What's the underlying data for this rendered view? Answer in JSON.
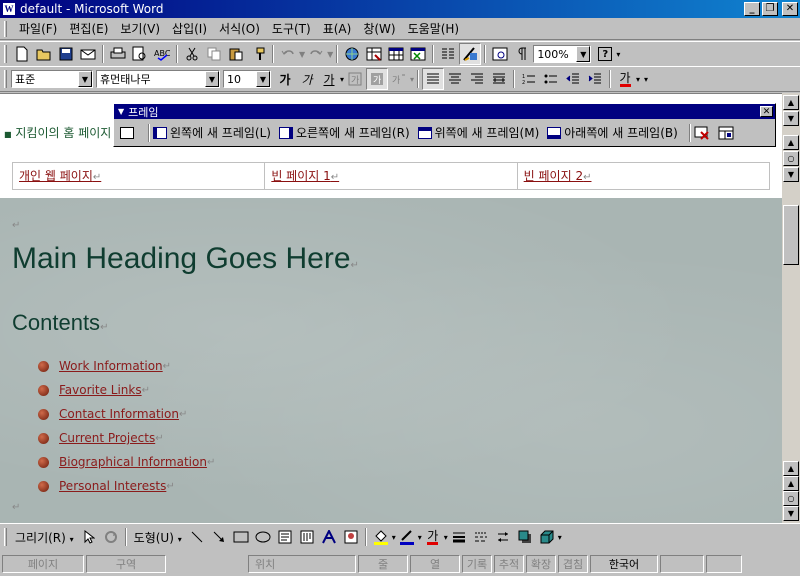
{
  "window": {
    "title": "default - Microsoft Word",
    "app_icon": "W",
    "min_label": "_",
    "max_label": "❐",
    "close_label": "✕"
  },
  "menu": [
    "파일(F)",
    "편집(E)",
    "보기(V)",
    "삽입(I)",
    "서식(O)",
    "도구(T)",
    "표(A)",
    "창(W)",
    "도움말(H)"
  ],
  "toolbar": {
    "zoom": "100%",
    "help_glyph": "?"
  },
  "formatting": {
    "style": "표준",
    "font": "휴먼태나무",
    "size": "10",
    "bold": "가",
    "italic": "가",
    "underline": "가",
    "font_color_glyph": "가"
  },
  "frames_toolbar": {
    "title": "프레임",
    "buttons": [
      "왼쪽에 새 프레임(L)",
      "오른쪽에 새 프레임(R)",
      "위쪽에 새 프레임(M)",
      "아래쪽에 새 프레임(B)"
    ]
  },
  "document": {
    "site_title": "지킴이의 홈 페이지",
    "nav_links": [
      "개인 웹 페이지",
      "빈 페이지 1",
      "빈 페이지 2"
    ],
    "heading": "Main Heading Goes Here",
    "contents_heading": "Contents",
    "toc": [
      "Work Information",
      "Favorite Links",
      "Contact Information",
      "Current Projects",
      "Biographical Information",
      "Personal Interests"
    ],
    "paragraph_mark": "↵"
  },
  "drawing_toolbar": {
    "draw_label": "그리기(R)",
    "autoshape_label": "도형(U)",
    "font_color_glyph": "가"
  },
  "statusbar": {
    "page": "페이지",
    "section": "구역",
    "position": "위치",
    "line": "줄",
    "column": "열",
    "rec": "기록",
    "trk": "추적",
    "ext": "확장",
    "ovr": "겹침",
    "language": "한국어"
  }
}
